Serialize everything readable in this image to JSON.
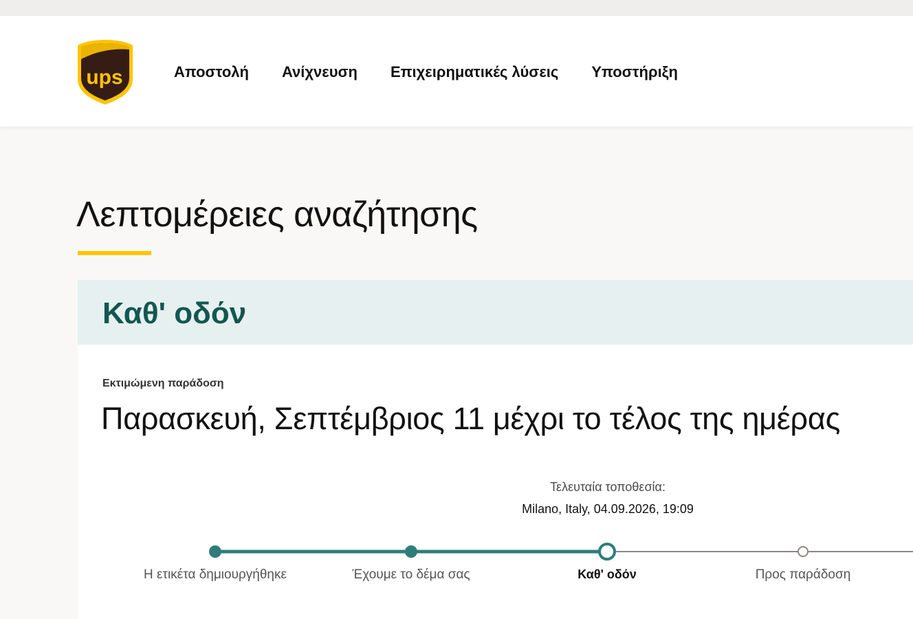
{
  "header": {
    "logo_text": "ups",
    "nav": [
      {
        "label": "Αποστολή"
      },
      {
        "label": "Ανίχνευση"
      },
      {
        "label": "Επιχειρηματικές λύσεις"
      },
      {
        "label": "Υποστήριξη"
      }
    ]
  },
  "page": {
    "title": "Λεπτομέρειες αναζήτησης"
  },
  "status": {
    "label": "Καθ' οδόν"
  },
  "delivery": {
    "estimated_label": "Εκτιμώμενη παράδοση",
    "estimated_date": "Παρασκευή, Σεπτέμβριος 11 μέχρι το τέλος της ημέρας"
  },
  "last_location": {
    "label": "Τελευταία τοποθεσία:",
    "value": "Milano, Italy, 04.09.2026, 19:09"
  },
  "progress": {
    "steps": [
      {
        "label": "Η ετικέτα δημιουργήθηκε",
        "state": "done"
      },
      {
        "label": "Έχουμε το δέμα σας",
        "state": "done"
      },
      {
        "label": "Καθ' οδόν",
        "state": "current"
      },
      {
        "label": "Προς παράδοση",
        "state": "pending"
      }
    ]
  },
  "colors": {
    "brand_brown": "#351c15",
    "brand_gold": "#ffc400",
    "status_teal": "#14574f",
    "progress_teal": "#2f7d7a",
    "pending_gray": "#8c8583"
  }
}
